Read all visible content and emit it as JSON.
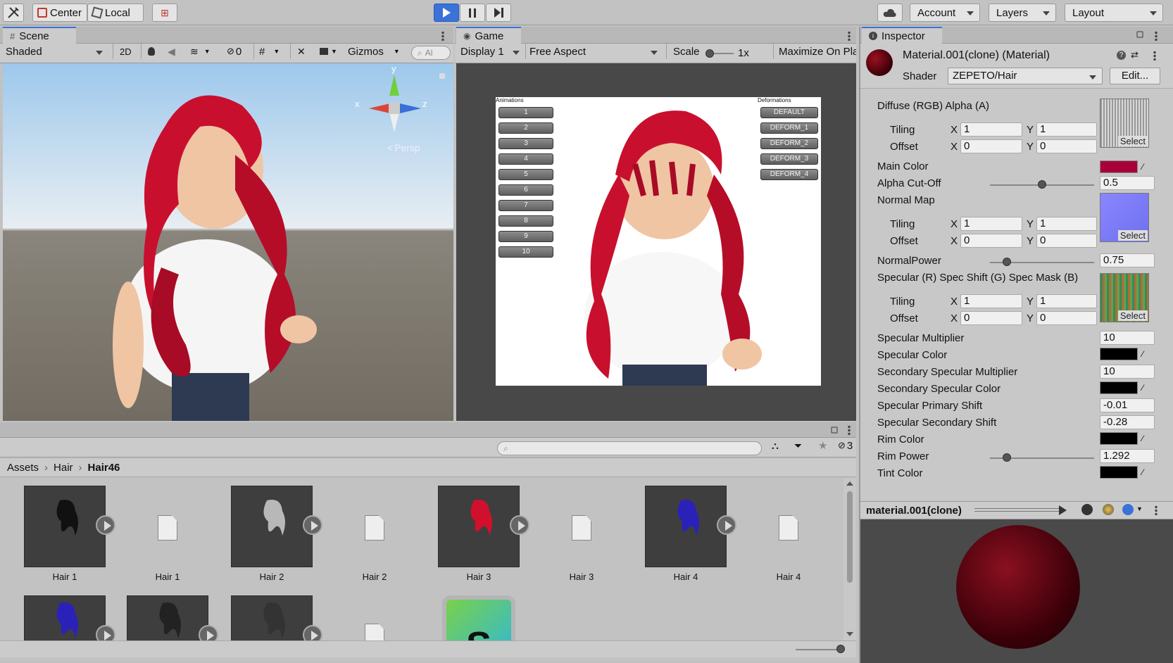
{
  "toolbar": {
    "pivot_label": "Center",
    "space_label": "Local",
    "account_label": "Account",
    "layers_label": "Layers",
    "layout_label": "Layout"
  },
  "scene": {
    "tab_label": "Scene",
    "shading_mode": "Shaded",
    "mode_2d": "2D",
    "hidden_count": "0",
    "gizmos_label": "Gizmos",
    "search_placeholder": "Al",
    "persp_label": "Persp",
    "axis_y": "y",
    "axis_x": "x",
    "axis_z": "z"
  },
  "game": {
    "tab_label": "Game",
    "display": "Display 1",
    "aspect": "Free Aspect",
    "scale_label": "Scale",
    "scale_value": "1x",
    "maximize_label": "Maximize On Pla",
    "animations_title": "Animations",
    "animations": [
      "1",
      "2",
      "3",
      "4",
      "5",
      "6",
      "7",
      "8",
      "9",
      "10"
    ],
    "deformations_title": "Deformations",
    "deformations": [
      "DEFAULT",
      "DEFORM_1",
      "DEFORM_2",
      "DEFORM_3",
      "DEFORM_4"
    ]
  },
  "inspector": {
    "tab_label": "Inspector",
    "material_title": "Material.001(clone) (Material)",
    "shader_label": "Shader",
    "shader_value": "ZEPETO/Hair",
    "edit_label": "Edit...",
    "tiling_label": "Tiling",
    "offset_label": "Offset",
    "x_label": "X",
    "y_label": "Y",
    "select_label": "Select",
    "diffuse_label": "Diffuse (RGB) Alpha (A)",
    "diffuse_tiling_x": "1",
    "diffuse_tiling_y": "1",
    "diffuse_offset_x": "0",
    "diffuse_offset_y": "0",
    "main_color_label": "Main Color",
    "alpha_cutoff_label": "Alpha Cut-Off",
    "alpha_cutoff_value": "0.5",
    "normal_map_label": "Normal Map",
    "normal_tiling_x": "1",
    "normal_tiling_y": "1",
    "normal_offset_x": "0",
    "normal_offset_y": "0",
    "normal_power_label": "NormalPower",
    "normal_power_value": "0.75",
    "specular_tex_label": "Specular (R) Spec Shift (G) Spec Mask (B)",
    "spec_tiling_x": "1",
    "spec_tiling_y": "1",
    "spec_offset_x": "0",
    "spec_offset_y": "0",
    "spec_mult_label": "Specular Multiplier",
    "spec_mult_value": "10",
    "spec_color_label": "Specular Color",
    "sec_spec_mult_label": "Secondary Specular Multiplier",
    "sec_spec_mult_value": "10",
    "sec_spec_color_label": "Secondary Specular Color",
    "spec_primary_shift_label": "Specular Primary Shift",
    "spec_primary_shift_value": "-0.01",
    "spec_secondary_shift_label": "Specular Secondary Shift",
    "spec_secondary_shift_value": "-0.28",
    "rim_color_label": "Rim Color",
    "rim_power_label": "Rim Power",
    "rim_power_value": "1.292",
    "tint_color_label": "Tint Color",
    "preview_title": "material.001(clone)"
  },
  "colors": {
    "main_color": "#a8003a",
    "hair_red": "#c8102e",
    "accent_blue": "#3a72d8"
  },
  "project": {
    "breadcrumb": [
      "Assets",
      "Hair",
      "Hair46"
    ],
    "hidden_count": "3",
    "assets_row1": [
      "Hair 1",
      "Hair 1",
      "Hair 2",
      "Hair 2",
      "Hair 3",
      "Hair 3",
      "Hair 4",
      "Hair 4"
    ]
  }
}
